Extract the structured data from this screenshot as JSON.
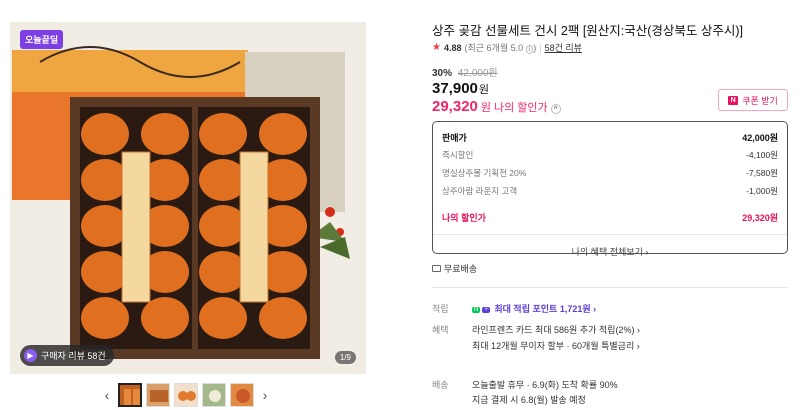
{
  "gallery": {
    "today_badge": "오늘끝딜",
    "review_chip": "구매자 리뷰 58건",
    "counter": "1/9",
    "thumb_count": 5
  },
  "product": {
    "title": "상주 곶감 선물세트 건시 2팩 [원산지:국산(경상북도 상주시)]",
    "rating": "4.88",
    "rating_sub": "(최근 6개월 5.0",
    "rating_sub_end": ")",
    "review_link": "58건 리뷰",
    "discount_pct": "30%",
    "original_price": "42,000원",
    "price": "37,900",
    "price_unit": "원",
    "my_price": "29,320",
    "my_price_unit": "원",
    "my_price_label": "나의 할인가",
    "coupon_label": "쿠폰 받기"
  },
  "breakdown": {
    "rows": [
      {
        "label": "판매가",
        "value": "42,000원"
      },
      {
        "label": "즉시할인",
        "value": "-4,100원"
      },
      {
        "label": "명실상주몰 기획전 20%",
        "value": "-7,580원"
      },
      {
        "label": "상주아람 라운지 고객",
        "value": "-1,000원"
      }
    ],
    "my_label": "나의 할인가",
    "my_value": "29,320원",
    "more_label": "나의 혜택 전체보기"
  },
  "shipping": {
    "free_label": "무료배송"
  },
  "benefits": {
    "points_label": "적립",
    "points_value": "최대 적립 포인트 1,721원",
    "benefit_label": "혜택",
    "benefit_line1": "라인프렌즈 카드 최대 586원 추가 적립(2%)",
    "benefit_line2": "최대 12개월 무이자 할부 · 60개월 특별금리",
    "delivery_label": "배송",
    "delivery_line1": "오늘출발 휴무 · 6.9(화) 도착 확률 90%",
    "delivery_line2": "지금 결제 시 6.8(월) 발송 예정"
  },
  "colors": {
    "accent_pink": "#f0256b",
    "purple": "#7b3fe4",
    "persimmon": "#e07020"
  }
}
